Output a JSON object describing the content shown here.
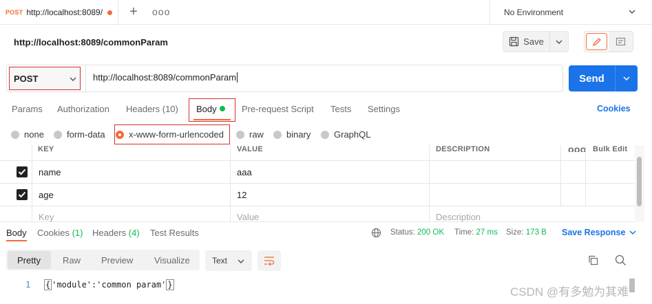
{
  "tabstrip": {
    "tab": {
      "method": "POST",
      "url": "http://localhost:8089/"
    },
    "environment": "No Environment"
  },
  "header": {
    "title": "http://localhost:8089/commonParam",
    "save_label": "Save"
  },
  "request": {
    "method": "POST",
    "url": "http://localhost:8089/commonParam",
    "send_label": "Send"
  },
  "request_tabs": {
    "params": "Params",
    "authorization": "Authorization",
    "headers": "Headers (10)",
    "body": "Body",
    "pre_request": "Pre-request Script",
    "tests": "Tests",
    "settings": "Settings",
    "cookies": "Cookies"
  },
  "body_types": [
    {
      "label": "none"
    },
    {
      "label": "form-data"
    },
    {
      "label": "x-www-form-urlencoded"
    },
    {
      "label": "raw"
    },
    {
      "label": "binary"
    },
    {
      "label": "GraphQL"
    }
  ],
  "params_table": {
    "headers": {
      "key": "KEY",
      "value": "VALUE",
      "description": "DESCRIPTION",
      "bulk_edit": "Bulk Edit"
    },
    "rows": [
      {
        "key": "name",
        "value": "aaa"
      },
      {
        "key": "age",
        "value": "12"
      }
    ],
    "placeholders": {
      "key": "Key",
      "value": "Value",
      "description": "Description"
    }
  },
  "response": {
    "tabs": {
      "body": "Body",
      "cookies": "Cookies",
      "cookies_count": "(1)",
      "headers": "Headers",
      "headers_count": "(4)",
      "test_results": "Test Results"
    },
    "status": {
      "status_label": "Status:",
      "status_value": "200 OK",
      "time_label": "Time:",
      "time_value": "27 ms",
      "size_label": "Size:",
      "size_value": "173 B"
    },
    "save_response": "Save Response",
    "views": [
      "Pretty",
      "Raw",
      "Preview",
      "Visualize"
    ],
    "format": "Text",
    "line_number": "1",
    "code": {
      "open": "{",
      "content": "'module':'common param'",
      "close": "}"
    }
  },
  "watermark": "CSDN @有多勉为其难",
  "colors": {
    "accent": "#f26b3a",
    "send": "#1a73e8",
    "success": "#0cbb52",
    "highlight_box": "#d32f2f"
  }
}
